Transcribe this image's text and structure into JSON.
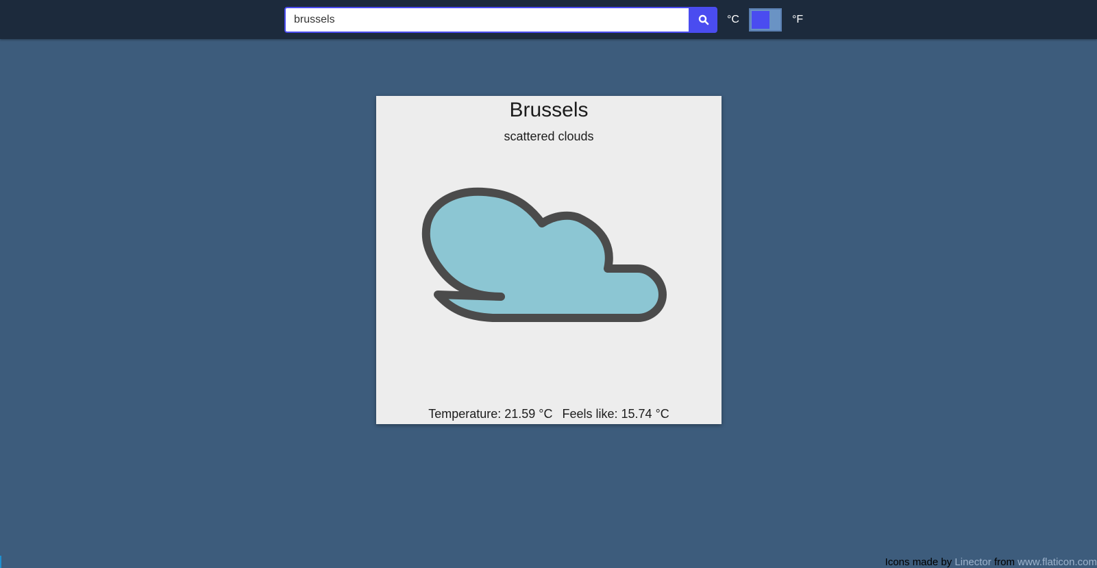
{
  "search": {
    "value": "brussels",
    "placeholder": ""
  },
  "units": {
    "celsius_label": "°C",
    "fahrenheit_label": "°F",
    "selected": "°C"
  },
  "weather": {
    "city": "Brussels",
    "description": "scattered clouds",
    "icon": "cloud-icon",
    "temperature_text": "Temperature: 21.59 °C",
    "feels_like_text": "Feels like: 15.74 °C"
  },
  "footer": {
    "prefix": "Icons made by",
    "author": "Linector",
    "middle": "from",
    "site": "www.flaticon.com"
  },
  "colors": {
    "topbar": "#1c2a3c",
    "background": "#3d5c7c",
    "accent": "#4a4cf0",
    "card": "#ededed",
    "cloud_fill": "#8cc6d3",
    "cloud_stroke": "#4b4b4b"
  }
}
